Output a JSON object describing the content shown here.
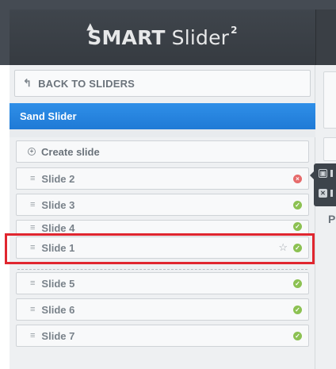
{
  "header": {
    "logo_main": "SMART",
    "logo_light": "Slider",
    "logo_sup": "2"
  },
  "sidebar": {
    "back_label": "BACK TO SLIDERS",
    "slider_name": "Sand Slider",
    "create_label": "Create slide",
    "slides": [
      {
        "label": "Slide 2",
        "status": "disabled"
      },
      {
        "label": "Slide 3",
        "status": "published"
      },
      {
        "label": "Slide 4",
        "status": "published"
      },
      {
        "label": "Slide 1",
        "status": "published",
        "starred": false
      },
      {
        "label": "Slide 5",
        "status": "published"
      },
      {
        "label": "Slide 6",
        "status": "published"
      },
      {
        "label": "Slide 7",
        "status": "published"
      }
    ]
  },
  "right_panel": {
    "letter": "P"
  },
  "colors": {
    "accent": "#1f7ad6",
    "highlight": "#e0262f",
    "ok": "#8cc152",
    "error": "#e66b6b"
  }
}
